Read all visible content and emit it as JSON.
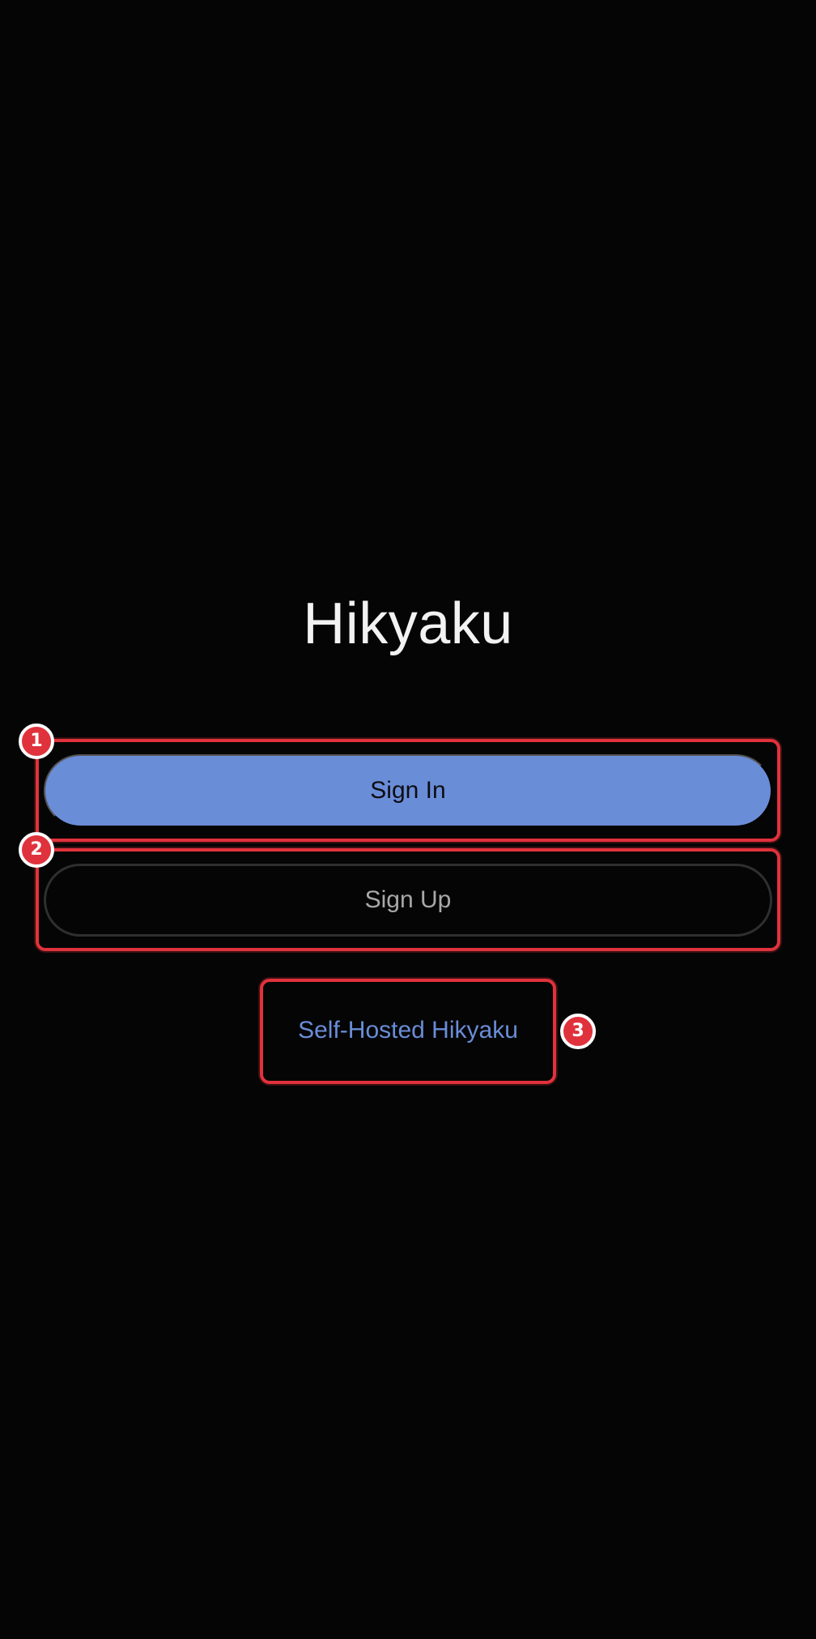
{
  "app": {
    "title": "Hikyaku"
  },
  "actions": {
    "sign_in_label": "Sign In",
    "sign_up_label": "Sign Up",
    "self_hosted_label": "Self-Hosted Hikyaku"
  },
  "annotations": {
    "badge_1": "1",
    "badge_2": "2",
    "badge_3": "3"
  },
  "colors": {
    "background": "#050505",
    "accent": "#6a8dd8",
    "annotation_red": "#e0323c"
  }
}
